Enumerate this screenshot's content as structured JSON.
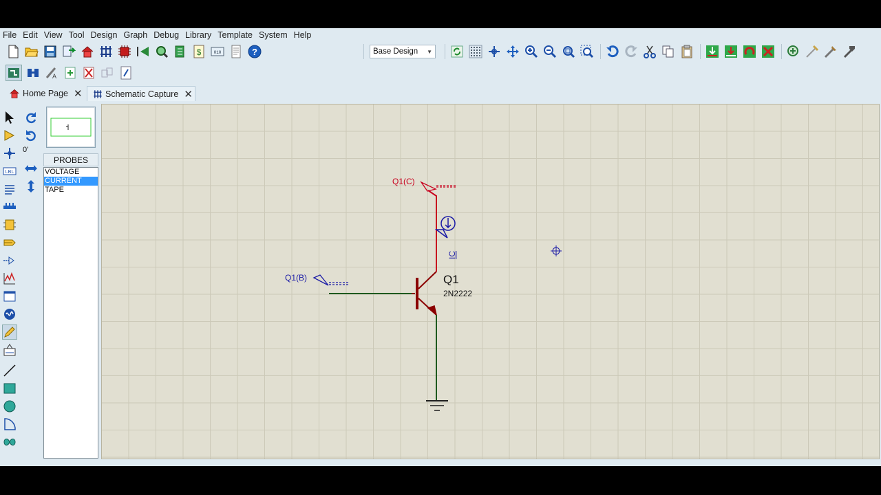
{
  "menu": [
    "File",
    "Edit",
    "View",
    "Tool",
    "Design",
    "Graph",
    "Debug",
    "Library",
    "Template",
    "System",
    "Help"
  ],
  "toolbar": {
    "design_select": "Base Design",
    "file_icons": [
      "new-file-icon",
      "open-folder-icon",
      "save-icon",
      "import-icon",
      "home-icon",
      "netlist-icon",
      "component-icon",
      "back-annotate-icon",
      "zoom-board-icon",
      "bom-icon",
      "cost-icon",
      "binary-icon",
      "report-icon",
      "help-icon"
    ],
    "view_icons": [
      "refresh-icon",
      "grid-icon",
      "origin-icon",
      "pan-icon",
      "zoom-in-icon",
      "zoom-out-icon",
      "zoom-all-icon",
      "zoom-area-icon"
    ],
    "edit_icons": [
      "undo-icon",
      "redo-icon",
      "cut-icon",
      "copy-icon",
      "paste-icon",
      "block-copy-icon",
      "block-move-icon",
      "block-rotate-icon",
      "block-delete-icon",
      "pick-device-icon",
      "make-device-icon",
      "packaging-tool-icon",
      "decompose-icon"
    ]
  },
  "tabs": [
    {
      "label": "Home Page",
      "icon": "home-icon"
    },
    {
      "label": "Schematic Capture",
      "icon": "schematic-icon"
    }
  ],
  "rotation": {
    "angle": "0'"
  },
  "probes": {
    "header": "PROBES",
    "items": [
      "VOLTAGE",
      "CURRENT",
      "TAPE"
    ],
    "selected": "CURRENT"
  },
  "schematic": {
    "transistor": {
      "ref": "Q1",
      "value": "2N2222"
    },
    "terminal_collector": "Q1(C)",
    "terminal_base": "Q1(B)",
    "current_probe": "IC"
  },
  "colors": {
    "wire_red": "#c8001e",
    "wire_green": "#1e5a1e",
    "component_maroon": "#8b0000",
    "terminal_blue": "#1a1aa6",
    "selection_blue": "#3399ff"
  }
}
